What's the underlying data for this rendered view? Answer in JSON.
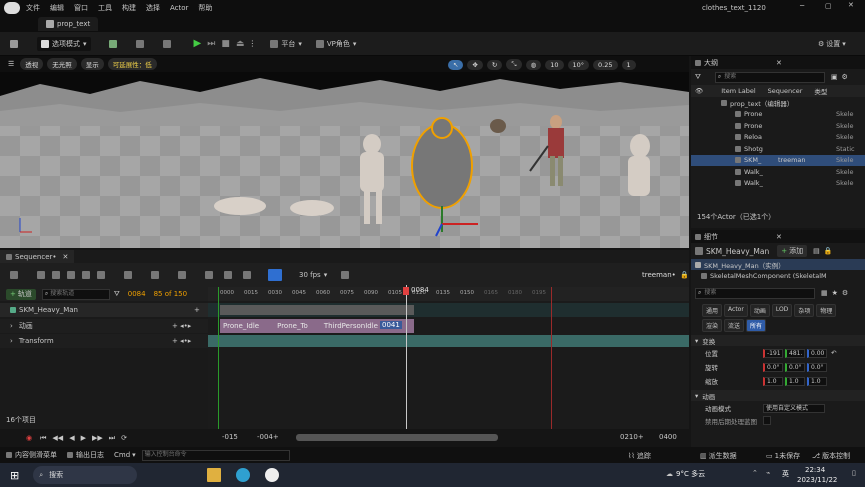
{
  "window": {
    "title": "clothes_text_1120",
    "menu": [
      "文件",
      "编辑",
      "窗口",
      "工具",
      "构建",
      "选择",
      "Actor",
      "帮助"
    ],
    "doc_tab": "prop_text"
  },
  "toolbar": {
    "mode": "选项模式",
    "platform": "平台",
    "vp": "VP角色",
    "settings": "设置"
  },
  "viewport": {
    "perspective": "透视",
    "lit": "无光照",
    "show": "显示",
    "scalability": "可延展性：低",
    "grid": "10",
    "angle": "10°",
    "scale": "0.25",
    "cam": "1"
  },
  "sequencer": {
    "tab": "Sequencer•",
    "fps": "30 fps",
    "sequence_name": "treeman•",
    "add_track": "轨道",
    "search_placeholder": "搜索轨道",
    "frame": "0084",
    "range": "85 of 150",
    "playhead": "0084",
    "tracks": [
      {
        "name": "SKM_Heavy_Man"
      },
      {
        "name": "动画"
      },
      {
        "name": "Transform"
      }
    ],
    "ruler": [
      "0000",
      "0015",
      "0030",
      "0045",
      "0060",
      "0075",
      "0090",
      "0105",
      "0120",
      "0135",
      "0150",
      "0165",
      "0180",
      "0195"
    ],
    "clips": [
      "Prone_Idle",
      "Prone_To",
      "ThirdPersonIdle",
      "0041"
    ],
    "item_count": "16个项目",
    "start": "-015",
    "start2": "-004+",
    "end": "0210+",
    "end2": "0400"
  },
  "outliner": {
    "title": "大纲",
    "search": "搜索",
    "col_label": "Item Label",
    "col_seq": "Sequencer",
    "col_type": "类型",
    "items": [
      {
        "label": "prop_text（编辑器）",
        "seq": "",
        "type": ""
      },
      {
        "label": "Prone",
        "seq": "",
        "type": "Skele"
      },
      {
        "label": "Prone",
        "seq": "",
        "type": "Skele"
      },
      {
        "label": "Reloa",
        "seq": "",
        "type": "Skele"
      },
      {
        "label": "Shotg",
        "seq": "",
        "type": "Static"
      },
      {
        "label": "SKM_",
        "seq": "treeman",
        "type": "Skele"
      },
      {
        "label": "Walk_",
        "seq": "",
        "type": "Skele"
      },
      {
        "label": "Walk_",
        "seq": "",
        "type": "Skele"
      }
    ],
    "count": "154个Actor（已选1个）"
  },
  "details": {
    "title": "细节",
    "object": "SKM_Heavy_Man",
    "add": "添加",
    "instance": "SKM_Heavy_Man（实例）",
    "component": "SkeletalMeshComponent (SkeletalM",
    "search": "搜索",
    "cats": [
      "通用",
      "Actor",
      "动画",
      "LOD",
      "杂项",
      "物理",
      "渲染",
      "流送",
      "所有"
    ],
    "transform": "变换",
    "pos_label": "位置",
    "rot_label": "旋转",
    "scale_label": "缩放",
    "pos": [
      "-191",
      "481.",
      "0.00"
    ],
    "rot": [
      "0.0°",
      "0.0°",
      "0.0°"
    ],
    "scl": [
      "1.0",
      "1.0",
      "1.0"
    ],
    "anim": "动画",
    "anim_mode_label": "动画模式",
    "anim_mode": "使用自定义模式",
    "anim_extra": "禁用后期处理蓝图"
  },
  "statusbar": {
    "content": "内容侧滑菜单",
    "output": "输出日志",
    "cmd": "Cmd",
    "console_placeholder": "输入控制台命令",
    "trace": "追踪",
    "derived": "派生数据",
    "unsaved": "1未保存",
    "source": "版本控制"
  },
  "taskbar": {
    "search": "搜索",
    "weather": "9°C 多云",
    "lang": "英",
    "time": "22:34",
    "date": "2023/11/22"
  }
}
